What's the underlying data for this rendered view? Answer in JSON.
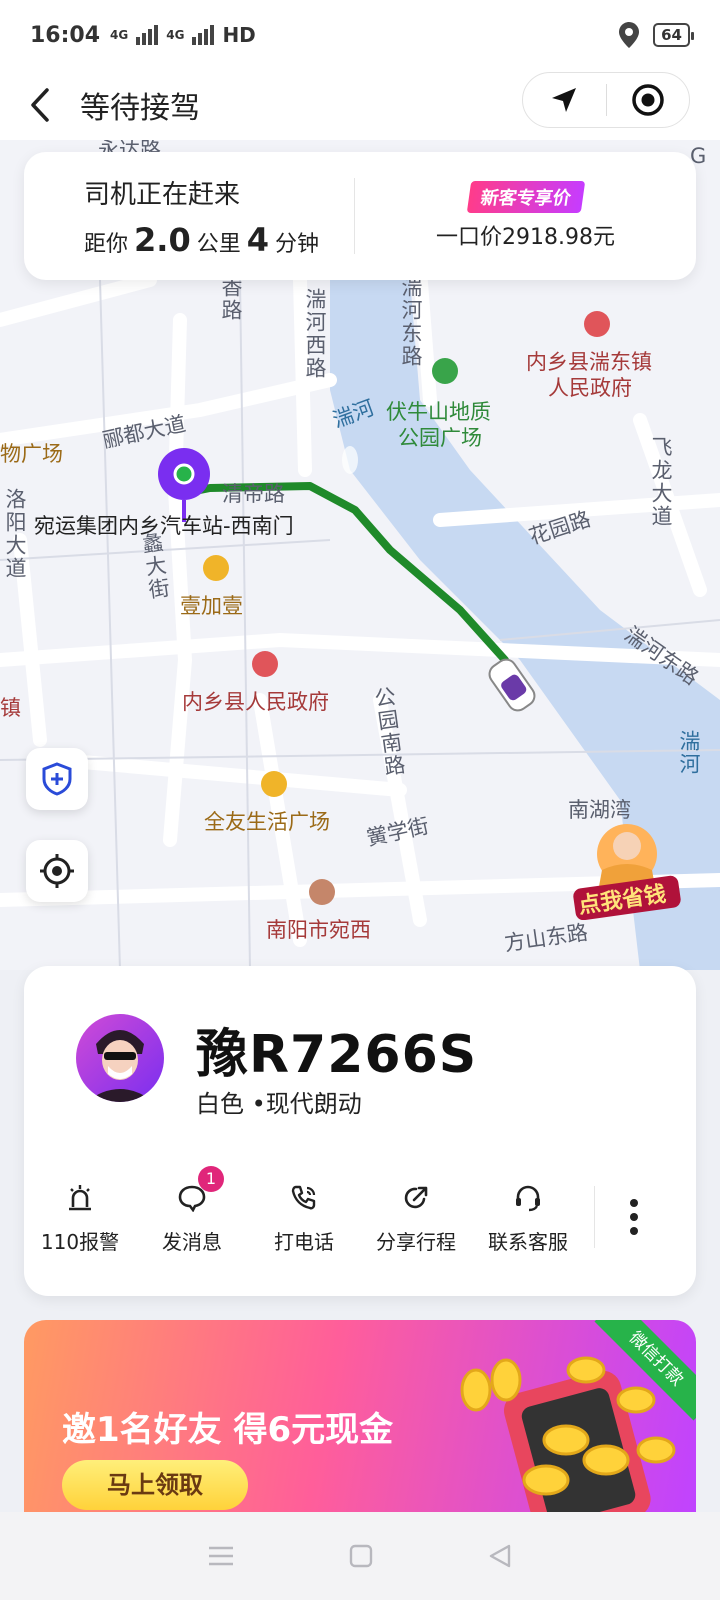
{
  "status_bar": {
    "time": "16:04",
    "network_1": "4G",
    "network_2": "4G",
    "hd": "HD",
    "battery": "64"
  },
  "header": {
    "title": "等待接驾"
  },
  "trip_info": {
    "status": "司机正在赶来",
    "distance_prefix": "距你",
    "distance_value": "2.0",
    "distance_unit": "公里",
    "minutes_value": "4",
    "minutes_unit": "分钟",
    "promo_tag": "新客专享价",
    "price": "一口价2918.98元"
  },
  "map": {
    "labels": {
      "yongda_road": "永达路",
      "xiang_road": "香路",
      "tuanhe_west": "湍河西路",
      "tuanhe_east": "湍河东路",
      "gov_dongzhen": "内乡县湍东镇",
      "gov_dongzhen_2": "人民政府",
      "tuan_river": "湍河",
      "park": "伏牛山地质",
      "park_2": "公园广场",
      "lidu": "郦都大道",
      "wuguangchang": "物广场",
      "feilong": "飞龙大道",
      "qingdi": "清帝路",
      "luoyang": "洛阳大道",
      "station": "宛运集团内乡汽车站-西南门",
      "yi_street": "蠡大街",
      "huayuan": "花园路",
      "yijiayi": "壹加壹",
      "tuanhe_east_road": "湍河东路",
      "zhen": "镇",
      "county_gov": "内乡县人民政府",
      "gongyuan_south": "公园南路",
      "tuan_river_2": "湍河",
      "nanhuwan": "南湖湾",
      "quanyou": "全友生活广场",
      "huangxue": "黉学街",
      "school": "南阳市宛西",
      "fangshan": "方山东路",
      "promo_badge": "点我省钱",
      "g": "G",
      "huang": "黄"
    }
  },
  "driver": {
    "plate": "豫R7266S",
    "car": "白色 •现代朗动"
  },
  "actions": [
    {
      "label": "110报警",
      "icon": "alarm-icon"
    },
    {
      "label": "发消息",
      "icon": "message-icon",
      "count": "1"
    },
    {
      "label": "打电话",
      "icon": "phone-icon"
    },
    {
      "label": "分享行程",
      "icon": "share-icon"
    },
    {
      "label": "联系客服",
      "icon": "headset-icon"
    }
  ],
  "banner": {
    "text": "邀1名好友 得6元现金",
    "button": "马上领取",
    "ribbon": "微信打款"
  },
  "colors": {
    "route": "#1f8a2a",
    "accent": "#7a2ef0",
    "badge": "#e0267a"
  }
}
